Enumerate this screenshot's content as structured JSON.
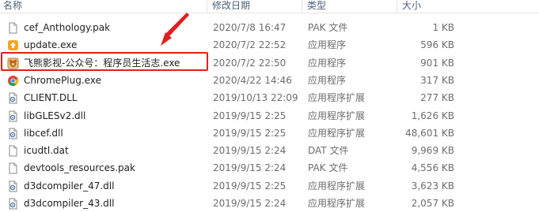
{
  "columns": {
    "name": "名称",
    "date": "修改日期",
    "type": "类型",
    "size": "大小"
  },
  "files": [
    {
      "name": "cef_Anthology.pak",
      "date": "2020/7/8 16:47",
      "type": "PAK 文件",
      "size": "1 KB",
      "icon": "blank-file-icon"
    },
    {
      "name": "update.exe",
      "date": "2020/7/2 22:52",
      "type": "应用程序",
      "size": "596 KB",
      "icon": "update-app-icon"
    },
    {
      "name": "飞熊影视-公众号：程序员生活志.exe",
      "date": "2020/7/2 22:50",
      "type": "应用程序",
      "size": "901 KB",
      "icon": "feixiong-app-icon"
    },
    {
      "name": "ChromePlug.exe",
      "date": "2020/4/22 14:46",
      "type": "应用程序",
      "size": "317 KB",
      "icon": "chrome-icon"
    },
    {
      "name": "CLIENT.DLL",
      "date": "2019/10/13 22:09",
      "type": "应用程序扩展",
      "size": "277 KB",
      "icon": "dll-icon"
    },
    {
      "name": "libGLESv2.dll",
      "date": "2019/9/15 2:25",
      "type": "应用程序扩展",
      "size": "1,626 KB",
      "icon": "dll-icon"
    },
    {
      "name": "libcef.dll",
      "date": "2019/9/15 2:25",
      "type": "应用程序扩展",
      "size": "48,601 KB",
      "icon": "dll-icon"
    },
    {
      "name": "icudtl.dat",
      "date": "2019/9/15 2:24",
      "type": "DAT 文件",
      "size": "9,969 KB",
      "icon": "blank-file-icon"
    },
    {
      "name": "devtools_resources.pak",
      "date": "2019/9/15 2:24",
      "type": "PAK 文件",
      "size": "4,556 KB",
      "icon": "blank-file-icon"
    },
    {
      "name": "d3dcompiler_47.dll",
      "date": "2019/9/15 2:25",
      "type": "应用程序扩展",
      "size": "3,623 KB",
      "icon": "dll-icon"
    },
    {
      "name": "d3dcompiler_43.dll",
      "date": "2019/9/15 2:24",
      "type": "应用程序扩展",
      "size": "2,057 KB",
      "icon": "dll-icon"
    }
  ],
  "annotation": {
    "highlight_color": "#e02020",
    "arrow_color": "#e02020"
  }
}
